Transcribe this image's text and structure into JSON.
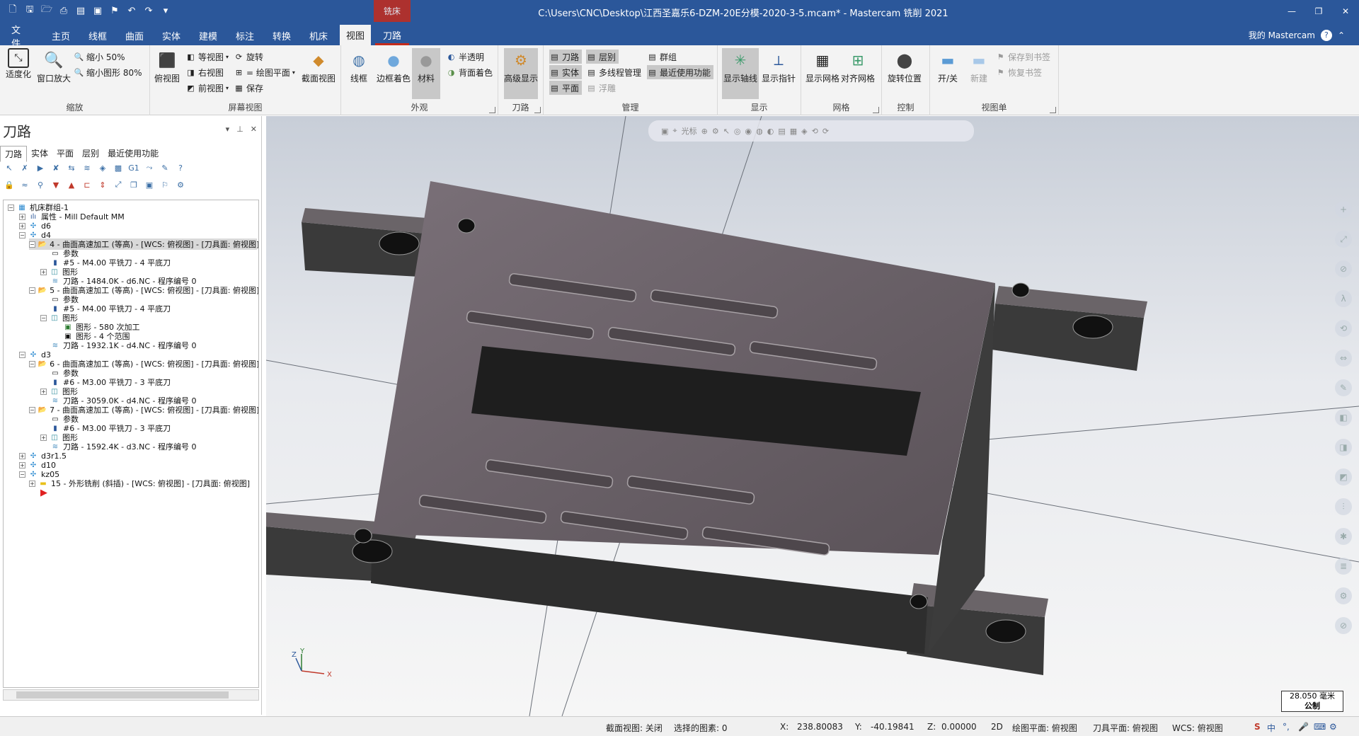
{
  "window": {
    "title": "C:\\Users\\CNC\\Desktop\\江西圣嘉乐6-DZM-20E分模-2020-3-5.mcam* - Mastercam 铣削 2021",
    "context_label": "铣床",
    "account": "我的 Mastercam"
  },
  "tabs": [
    {
      "label": "文件"
    },
    {
      "label": "主页"
    },
    {
      "label": "线框"
    },
    {
      "label": "曲面"
    },
    {
      "label": "实体"
    },
    {
      "label": "建模"
    },
    {
      "label": "标注"
    },
    {
      "label": "转换"
    },
    {
      "label": "机床"
    },
    {
      "label": "视图"
    },
    {
      "label": "刀路"
    }
  ],
  "ribbon": {
    "zoom": {
      "label": "缩放",
      "fit": "适度化",
      "window_zoom": "窗口放大",
      "zoom_out_50": "缩小 50%",
      "zoom_out_80": "缩小图形 80%"
    },
    "screen_view": {
      "label": "屏幕视图",
      "top": "俯视图",
      "iso": "等视图",
      "right": "右视图",
      "front": "前视图",
      "rotate": "旋转",
      "cplane": "= 绘图平面",
      "save": "保存",
      "section": "截面视图"
    },
    "appearance": {
      "label": "外观",
      "wireframe": "线框",
      "shaded_edges": "边框着色",
      "material": "材料",
      "translucent": "半透明",
      "backface": "背面着色"
    },
    "toolpath": {
      "label": "刀路",
      "advanced": "高级显示"
    },
    "manage": {
      "label": "管理",
      "toolpaths": "刀路",
      "solids": "实体",
      "planes": "平面",
      "levels": "层别",
      "multithread": "多线程管理",
      "float": "浮雕",
      "groups": "群组",
      "recent": "最近使用功能"
    },
    "display": {
      "label": "显示",
      "axes": "显示轴线",
      "gnomon": "显示指针"
    },
    "grid": {
      "label": "网格",
      "show_grid": "显示网格",
      "snap_grid": "对齐网格"
    },
    "control": {
      "label": "控制",
      "rotate_pos": "旋转位置"
    },
    "viewsheets": {
      "label": "视图单",
      "onoff": "开/关",
      "new": "新建",
      "save_bookmark": "保存到书签",
      "restore_bookmark": "恢复书签"
    }
  },
  "panel": {
    "title": "刀路",
    "tabs": [
      "刀路",
      "实体",
      "平面",
      "层别",
      "最近使用功能"
    ],
    "tree": [
      {
        "text": "机床群组-1"
      },
      {
        "text": "属性 - Mill Default MM"
      },
      {
        "text": "d6"
      },
      {
        "text": "d4"
      },
      {
        "text": "4 - 曲面高速加工 (等高) - [WCS: 俯视图] - [刀具面: 俯视图]"
      },
      {
        "text": "参数"
      },
      {
        "text": "#5 - M4.00 平铣刀 - 4 平底刀"
      },
      {
        "text": "图形"
      },
      {
        "text": "刀路 - 1484.0K - d6.NC - 程序编号 0"
      },
      {
        "text": "5 - 曲面高速加工 (等高) - [WCS: 俯视图] - [刀具面: 俯视图]"
      },
      {
        "text": "参数"
      },
      {
        "text": "#5 - M4.00 平铣刀 - 4 平底刀"
      },
      {
        "text": "图形"
      },
      {
        "text": "图形 - 580 次加工"
      },
      {
        "text": "图形 - 4 个范围"
      },
      {
        "text": "刀路 - 1932.1K - d4.NC - 程序编号 0"
      },
      {
        "text": "d3"
      },
      {
        "text": "6 - 曲面高速加工 (等高) - [WCS: 俯视图] - [刀具面: 俯视图]"
      },
      {
        "text": "参数"
      },
      {
        "text": "#6 - M3.00 平铣刀 - 3 平底刀"
      },
      {
        "text": "图形"
      },
      {
        "text": "刀路 - 3059.0K - d4.NC - 程序编号 0"
      },
      {
        "text": "7 - 曲面高速加工 (等高) - [WCS: 俯视图] - [刀具面: 俯视图]"
      },
      {
        "text": "参数"
      },
      {
        "text": "#6 - M3.00 平铣刀 - 3 平底刀"
      },
      {
        "text": "图形"
      },
      {
        "text": "刀路 - 1592.4K - d3.NC - 程序编号 0"
      },
      {
        "text": "d3r1.5"
      },
      {
        "text": "d10"
      },
      {
        "text": "kz05"
      },
      {
        "text": "15 - 外形铣削 (斜插) - [WCS: 俯视图] - [刀具面: 俯视图]"
      }
    ]
  },
  "viewport": {
    "toolbar_label": "光标",
    "axis_x": "X",
    "axis_y": "Y",
    "axis_z": "Z",
    "scale_value": "28.050 毫米",
    "scale_unit": "公制"
  },
  "status": {
    "section_view": "截面视图: 关闭",
    "selected": "选择的图素: 0",
    "x_label": "X:",
    "x_value": "238.80083",
    "y_label": "Y:",
    "y_value": "-40.19841",
    "z_label": "Z:",
    "z_value": "0.00000",
    "mode": "2D",
    "cplane": "绘图平面: 俯视图",
    "tplane": "刀具平面: 俯视图",
    "wcs": "WCS: 俯视图",
    "ime": "中"
  }
}
